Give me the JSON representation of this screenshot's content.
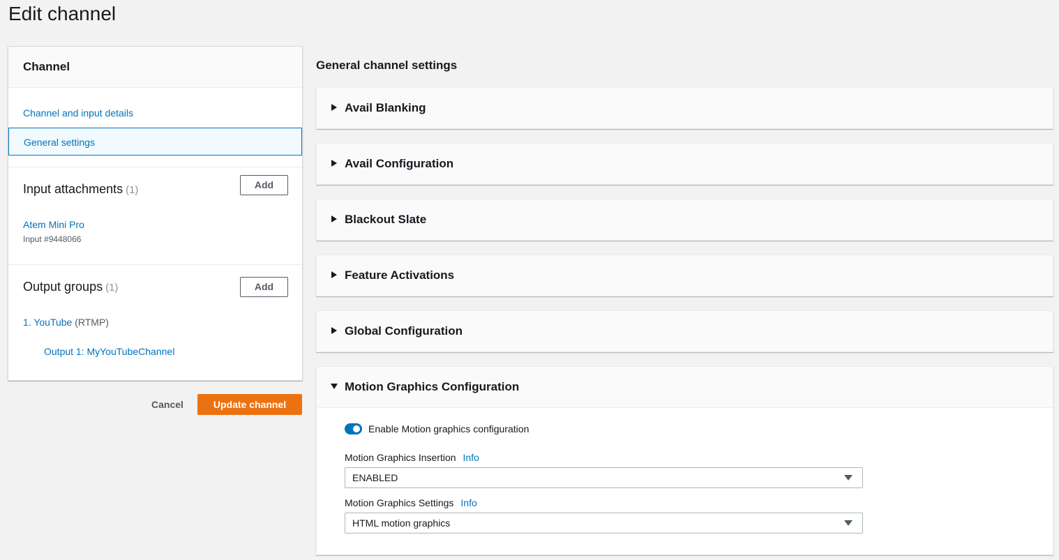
{
  "page": {
    "title": "Edit channel"
  },
  "left_panel": {
    "header": "Channel",
    "nav": [
      {
        "label": "Channel and input details"
      },
      {
        "label": "General settings"
      }
    ],
    "input_attachments": {
      "title": "Input attachments",
      "count": "(1)",
      "add_label": "Add",
      "item_name": "Atem Mini Pro",
      "item_id": "Input #9448066"
    },
    "output_groups": {
      "title": "Output groups",
      "count": "(1)",
      "add_label": "Add",
      "group_name": "1. YouTube",
      "group_protocol": "(RTMP)",
      "output_label": "Output 1: MyYouTubeChannel"
    }
  },
  "actions": {
    "cancel": "Cancel",
    "update": "Update channel"
  },
  "main": {
    "title": "General channel settings",
    "sections": [
      {
        "label": "Avail Blanking"
      },
      {
        "label": "Avail Configuration"
      },
      {
        "label": "Blackout Slate"
      },
      {
        "label": "Feature Activations"
      },
      {
        "label": "Global Configuration"
      }
    ],
    "motion_graphics": {
      "label": "Motion Graphics Configuration",
      "toggle_label": "Enable Motion graphics configuration",
      "toggle_on": true,
      "insertion_label": "Motion Graphics Insertion",
      "insertion_info": "Info",
      "insertion_value": "ENABLED",
      "settings_label": "Motion Graphics Settings",
      "settings_info": "Info",
      "settings_value": "HTML motion graphics"
    }
  },
  "colors": {
    "accent": "#0073bb",
    "primary_button": "#ec7211"
  }
}
